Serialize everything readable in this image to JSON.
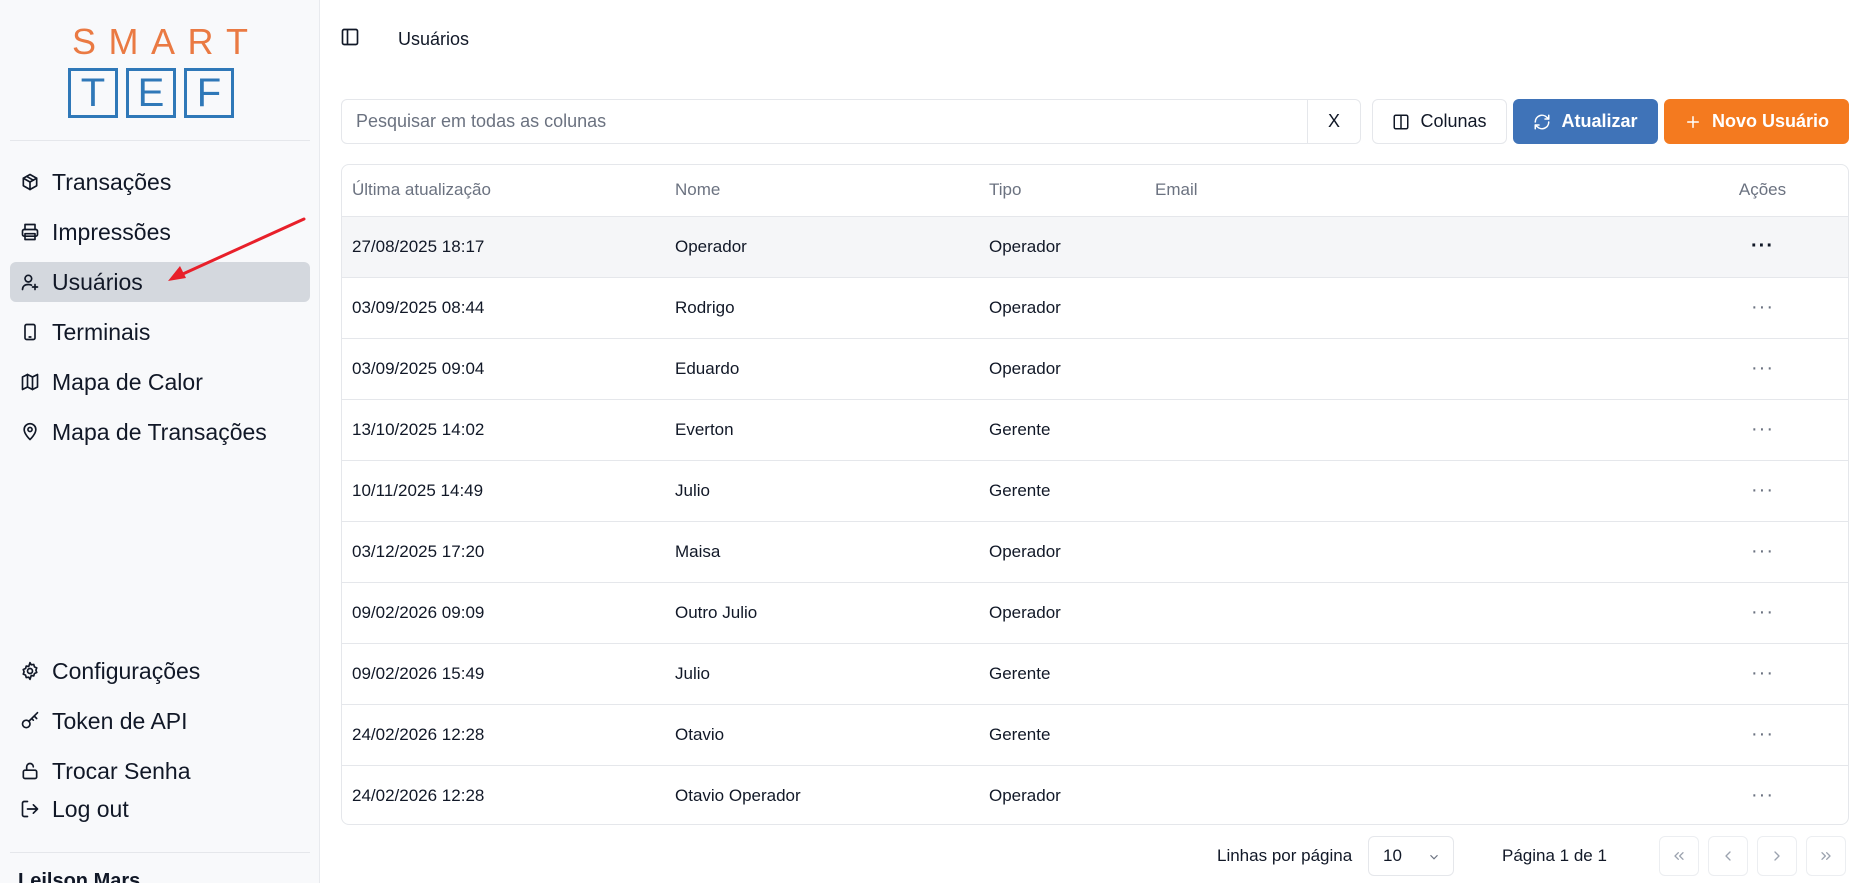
{
  "brand": {
    "top_letters": [
      "S",
      "M",
      "A",
      "R",
      "T"
    ],
    "box_letters": [
      "T",
      "E",
      "F"
    ],
    "accent_orange": "#ea7a43",
    "accent_blue": "#2f78b8"
  },
  "sidebar": {
    "items": [
      {
        "label": "Transações",
        "icon": "package-icon",
        "active": false
      },
      {
        "label": "Impressões",
        "icon": "printer-icon",
        "active": false
      },
      {
        "label": "Usuários",
        "icon": "user-plus-icon",
        "active": true
      },
      {
        "label": "Terminais",
        "icon": "tablet-icon",
        "active": false
      },
      {
        "label": "Mapa de Calor",
        "icon": "map-icon",
        "active": false
      },
      {
        "label": "Mapa de Transações",
        "icon": "map-pin-icon",
        "active": false
      }
    ],
    "bottom_items": [
      {
        "label": "Configurações",
        "icon": "gear-icon"
      },
      {
        "label": "Token de API",
        "icon": "key-icon"
      },
      {
        "label": "Trocar Senha",
        "icon": "lock-icon"
      },
      {
        "label": "Log out",
        "icon": "logout-icon"
      }
    ],
    "user_name": "Leilson Mars"
  },
  "header": {
    "page_title": "Usuários"
  },
  "toolbar": {
    "search_placeholder": "Pesquisar em todas as colunas",
    "clear_label": "X",
    "columns_label": "Colunas",
    "refresh_label": "Atualizar",
    "new_user_label": "Novo Usuário",
    "refresh_color": "#3f73b8",
    "new_user_color": "#f47a1f"
  },
  "table": {
    "headers": [
      "Última atualização",
      "Nome",
      "Tipo",
      "Email",
      "Ações"
    ],
    "rows": [
      {
        "updated": "27/08/2025 18:17",
        "name": "Operador",
        "type": "Operador",
        "email": ""
      },
      {
        "updated": "03/09/2025 08:44",
        "name": "Rodrigo",
        "type": "Operador",
        "email": ""
      },
      {
        "updated": "03/09/2025 09:04",
        "name": "Eduardo",
        "type": "Operador",
        "email": ""
      },
      {
        "updated": "13/10/2025 14:02",
        "name": "Everton",
        "type": "Gerente",
        "email": ""
      },
      {
        "updated": "10/11/2025 14:49",
        "name": "Julio",
        "type": "Gerente",
        "email": ""
      },
      {
        "updated": "03/12/2025 17:20",
        "name": "Maisa",
        "type": "Operador",
        "email": ""
      },
      {
        "updated": "09/02/2026 09:09",
        "name": "Outro Julio",
        "type": "Operador",
        "email": ""
      },
      {
        "updated": "09/02/2026 15:49",
        "name": "Julio",
        "type": "Gerente",
        "email": ""
      },
      {
        "updated": "24/02/2026 12:28",
        "name": "Otavio",
        "type": "Gerente",
        "email": ""
      },
      {
        "updated": "24/02/2026 12:28",
        "name": "Otavio Operador",
        "type": "Operador",
        "email": ""
      }
    ],
    "actions_glyph": "···"
  },
  "pagination": {
    "rows_per_page_label": "Linhas por página",
    "rows_per_page_value": "10",
    "page_info": "Página 1 de 1"
  }
}
